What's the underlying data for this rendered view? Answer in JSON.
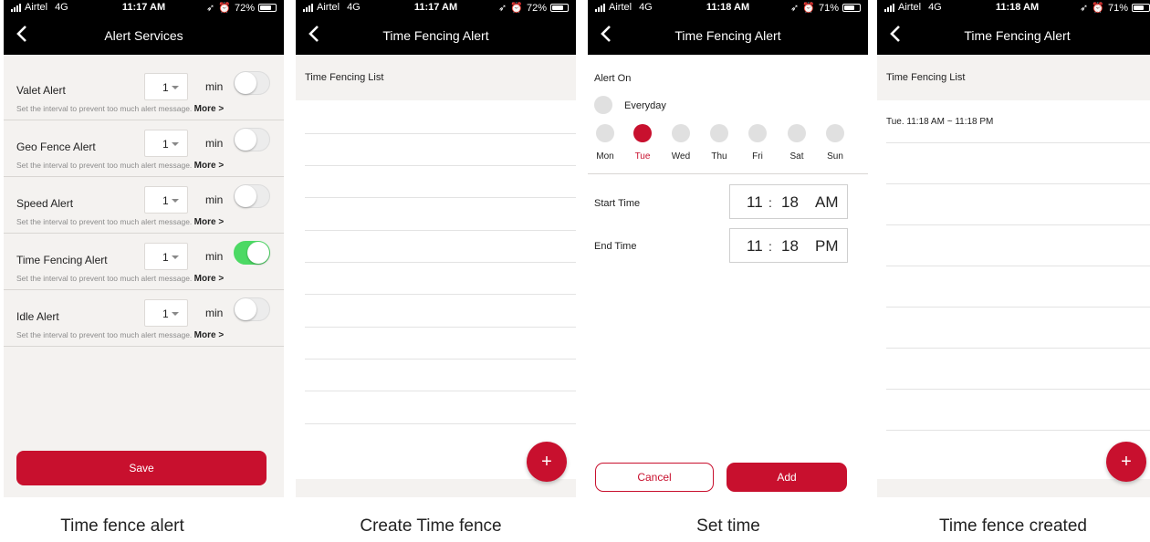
{
  "colors": {
    "accent": "#c8102e",
    "toggle_on": "#4cd964",
    "bar_bg": "#000000",
    "panel_bg": "#f4f2f0"
  },
  "screens": [
    {
      "status": {
        "carrier": "Airtel",
        "network": "4G",
        "time": "11:17 AM",
        "battery": "72%",
        "battery_level": 0.72
      },
      "title": "Alert Services",
      "alerts": [
        {
          "name": "Valet Alert",
          "interval": "1",
          "unit": "min",
          "enabled": false,
          "desc": "Set the interval to prevent too much alert message.",
          "more": "More >"
        },
        {
          "name": "Geo Fence Alert",
          "interval": "1",
          "unit": "min",
          "enabled": false,
          "desc": "Set the interval to prevent too much alert message.",
          "more": "More >"
        },
        {
          "name": "Speed Alert",
          "interval": "1",
          "unit": "min",
          "enabled": false,
          "desc": "Set the interval to prevent too much alert message.",
          "more": "More >"
        },
        {
          "name": "Time Fencing Alert",
          "interval": "1",
          "unit": "min",
          "enabled": true,
          "desc": "Set the interval to prevent too much alert message.",
          "more": "More >"
        },
        {
          "name": "Idle Alert",
          "interval": "1",
          "unit": "min",
          "enabled": false,
          "desc": "Set the interval to prevent too much alert message.",
          "more": "More >"
        }
      ],
      "save_label": "Save",
      "caption": "Time fence alert"
    },
    {
      "status": {
        "carrier": "Airtel",
        "network": "4G",
        "time": "11:17 AM",
        "battery": "72%",
        "battery_level": 0.72
      },
      "title": "Time Fencing Alert",
      "list_header": "Time Fencing List",
      "fab_label": "+",
      "caption": "Create Time fence"
    },
    {
      "status": {
        "carrier": "Airtel",
        "network": "4G",
        "time": "11:18 AM",
        "battery": "71%",
        "battery_level": 0.71
      },
      "title": "Time Fencing Alert",
      "alert_on_label": "Alert On",
      "everyday_label": "Everyday",
      "days": [
        {
          "label": "Mon",
          "selected": false
        },
        {
          "label": "Tue",
          "selected": true
        },
        {
          "label": "Wed",
          "selected": false
        },
        {
          "label": "Thu",
          "selected": false
        },
        {
          "label": "Fri",
          "selected": false
        },
        {
          "label": "Sat",
          "selected": false
        },
        {
          "label": "Sun",
          "selected": false
        }
      ],
      "start_time": {
        "label": "Start Time",
        "hour": "11",
        "minute": "18",
        "ampm": "AM"
      },
      "end_time": {
        "label": "End Time",
        "hour": "11",
        "minute": "18",
        "ampm": "PM"
      },
      "time_separator": ":",
      "cancel_label": "Cancel",
      "add_label": "Add",
      "caption": "Set time"
    },
    {
      "status": {
        "carrier": "Airtel",
        "network": "4G",
        "time": "11:18 AM",
        "battery": "71%",
        "battery_level": 0.71
      },
      "title": "Time Fencing Alert",
      "list_header": "Time Fencing List",
      "items": [
        "Tue. 11:18 AM ~ 11:18 PM"
      ],
      "fab_label": "+",
      "caption": "Time fence created"
    }
  ]
}
